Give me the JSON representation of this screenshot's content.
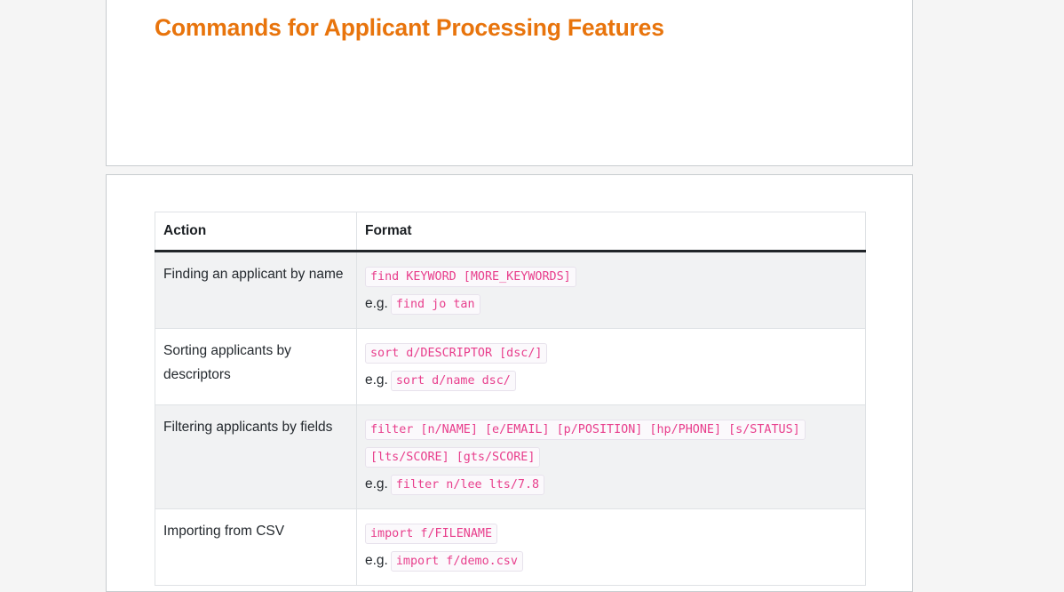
{
  "page": {
    "title": "Commands for Applicant Processing Features",
    "background_color": "#f5f5f5",
    "title_color": "#e8740c",
    "code_color": "#e83e8c",
    "eg_prefix": "e.g."
  },
  "table": {
    "headers": {
      "action": "Action",
      "format": "Format"
    },
    "rows": [
      {
        "action": "Finding an applicant by name",
        "format": "find KEYWORD [MORE_KEYWORDS]",
        "example": "find jo tan"
      },
      {
        "action": "Sorting applicants by descriptors",
        "format": "sort d/DESCRIPTOR [dsc/]",
        "example": "sort d/name dsc/"
      },
      {
        "action": "Filtering applicants by fields",
        "format": "filter [n/NAME] [e/EMAIL] [p/POSITION] [hp/PHONE] [s/STATUS] [lts/SCORE] [gts/SCORE]",
        "example": "filter n/lee lts/7.8"
      },
      {
        "action": "Importing from CSV",
        "format": "import f/FILENAME",
        "example": "import f/demo.csv"
      }
    ]
  }
}
